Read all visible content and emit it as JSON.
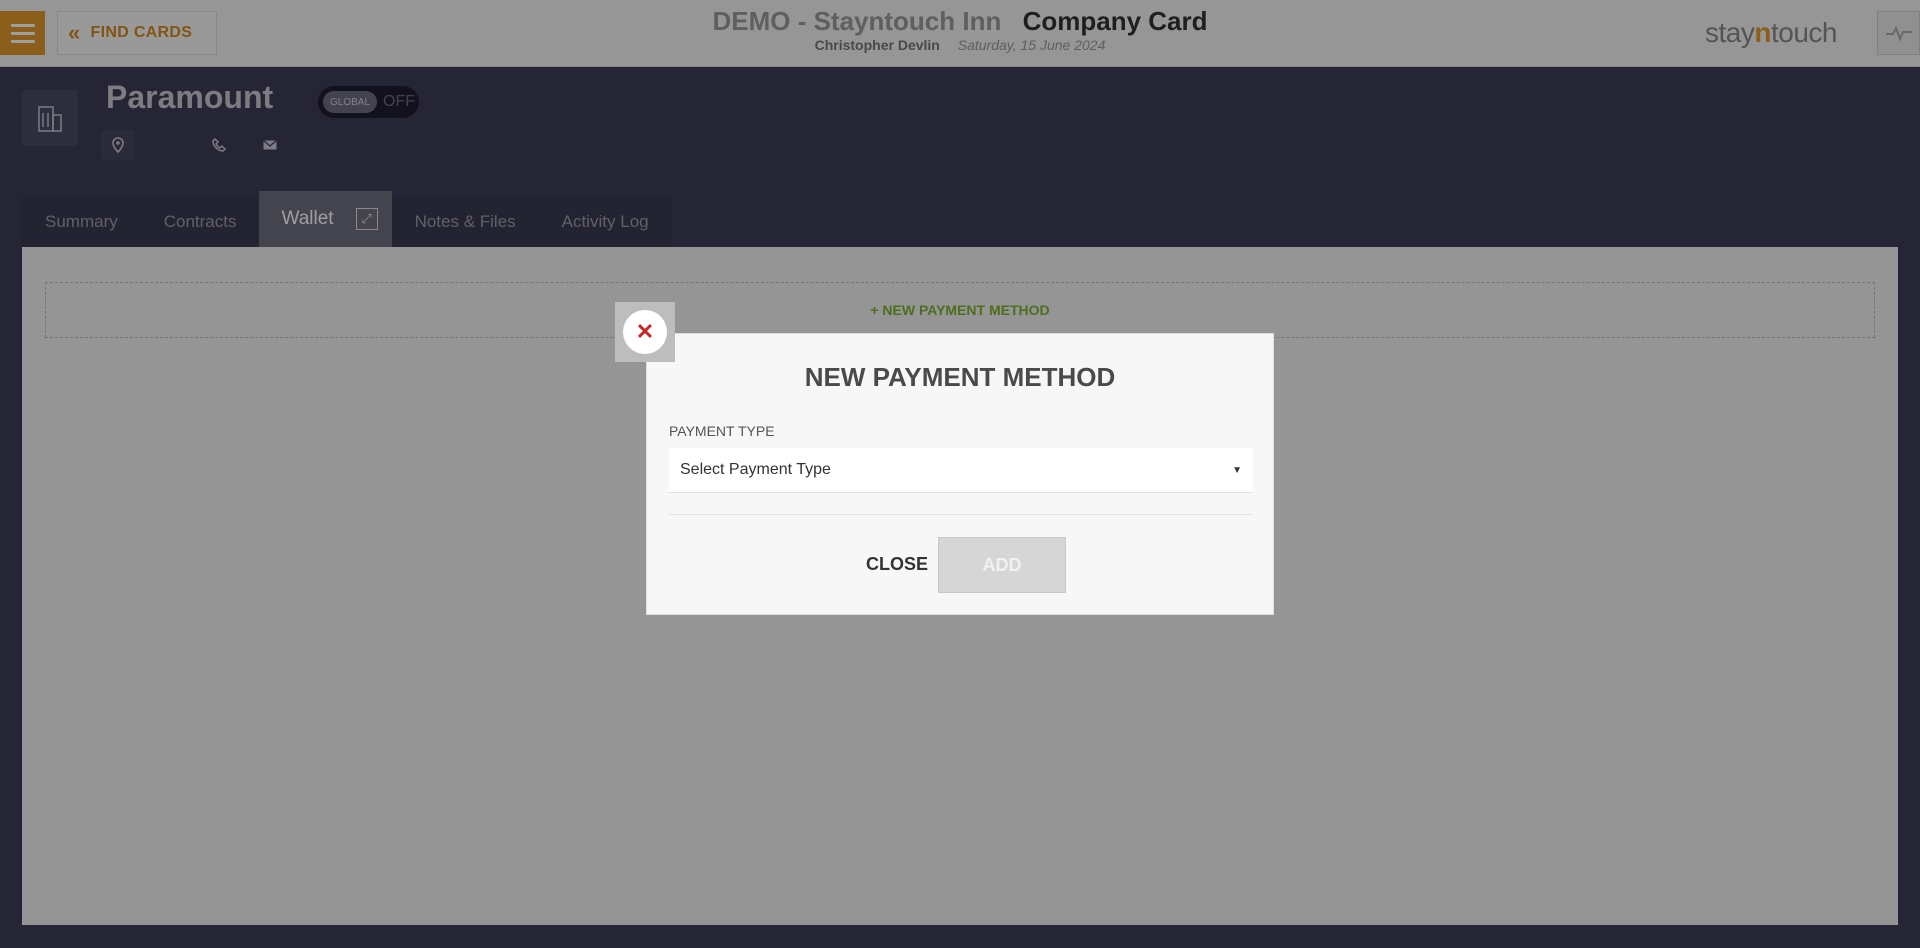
{
  "header": {
    "find_cards_label": "FIND CARDS",
    "hotel_name": "DEMO - Stayntouch Inn",
    "card_title": "Company Card",
    "user_name": "Christopher Devlin",
    "date": "Saturday, 15 June 2024",
    "logo_left": "stay",
    "logo_mid": "n",
    "logo_right": "touch"
  },
  "card": {
    "name": "Paramount",
    "global_label": "GLOBAL",
    "global_state": "OFF"
  },
  "tabs": [
    {
      "label": "Summary"
    },
    {
      "label": "Contracts"
    },
    {
      "label": "Wallet"
    },
    {
      "label": "Notes & Files"
    },
    {
      "label": "Activity Log"
    }
  ],
  "wallet": {
    "new_payment_link": "+ NEW PAYMENT METHOD"
  },
  "modal": {
    "title": "NEW PAYMENT METHOD",
    "payment_type_label": "PAYMENT TYPE",
    "payment_type_value": "Select Payment Type",
    "close_label": "CLOSE",
    "add_label": "ADD"
  },
  "icons": {
    "menu": "hamburger-icon",
    "back": "double-chevron-left-icon",
    "activity": "pulse-icon",
    "company": "building-icon",
    "location": "map-pin-icon",
    "phone": "phone-icon",
    "email": "envelope-icon",
    "expand": "expand-icon",
    "close": "close-icon"
  },
  "colors": {
    "accent": "#e09a2c",
    "header_bg": "#f2f2f2",
    "page_bg": "#3e3d57",
    "green_link": "#7fb02f",
    "close_x": "#c62828"
  }
}
